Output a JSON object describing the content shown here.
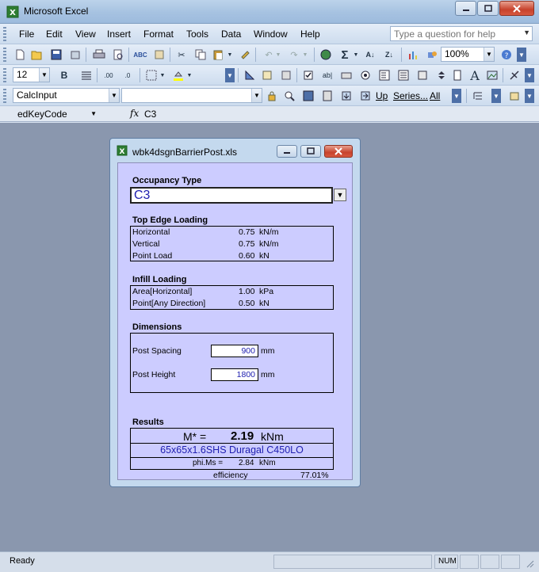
{
  "window": {
    "title": "Microsoft Excel"
  },
  "menu": [
    "File",
    "Edit",
    "View",
    "Insert",
    "Format",
    "Tools",
    "Data",
    "Window",
    "Help"
  ],
  "help_search": {
    "placeholder": "Type a question for help"
  },
  "toolbar": {
    "zoom": "100%",
    "font_size": "12",
    "style": "CalcInput",
    "up_label": "Up",
    "series_label": "Series...",
    "all_label": "All"
  },
  "formula_bar": {
    "name_box": "edKeyCode",
    "fx": "fx",
    "value": "C3"
  },
  "form": {
    "title": "wbk4dsgnBarrierPost.xls",
    "occupancy": {
      "heading": "Occupancy Type",
      "value": "C3"
    },
    "top_edge": {
      "heading": "Top Edge Loading",
      "rows": [
        {
          "label": "Horizontal",
          "value": "0.75",
          "unit": "kN/m"
        },
        {
          "label": "Vertical",
          "value": "0.75",
          "unit": "kN/m"
        },
        {
          "label": "Point Load",
          "value": "0.60",
          "unit": "kN"
        }
      ]
    },
    "infill": {
      "heading": "Infill Loading",
      "rows": [
        {
          "label": "Area[Horizontal]",
          "value": "1.00",
          "unit": "kPa"
        },
        {
          "label": "Point[Any Direction]",
          "value": "0.50",
          "unit": "kN"
        }
      ]
    },
    "dimensions": {
      "heading": "Dimensions",
      "spacing": {
        "label": "Post Spacing",
        "value": "900",
        "unit": "mm"
      },
      "height": {
        "label": "Post Height",
        "value": "1800",
        "unit": "mm"
      }
    },
    "results": {
      "heading": "Results",
      "moment_label": "M* =",
      "moment_value": "2.19",
      "moment_unit": "kNm",
      "section": "65x65x1.6SHS Duragal C450LO",
      "phims_label": "phi.Ms =",
      "phims_value": "2.84",
      "phims_unit": "kNm",
      "efficiency_label": "efficiency",
      "efficiency_value": "77.01%"
    }
  },
  "status": {
    "text": "Ready",
    "num": "NUM"
  }
}
